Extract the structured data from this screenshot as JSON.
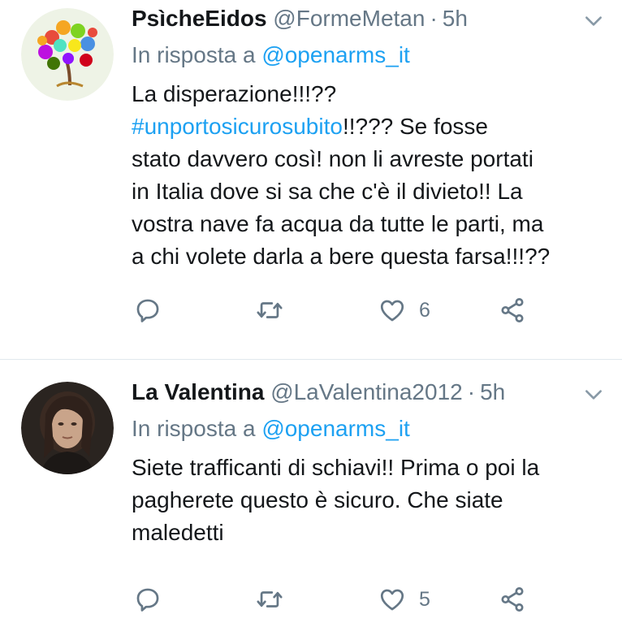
{
  "tweets": [
    {
      "author_name": "PsìcheEidos",
      "handle": "@FormeMetan",
      "separator": "·",
      "time": "5h",
      "reply_prefix": "In risposta a",
      "reply_to": "@openarms_it",
      "body_line1": "La disperazione!!!??",
      "hashtag": "#unportosicurosubito",
      "body_line2_rest": "!!??? Se fosse",
      "body_line3": "stato davvero così! non li avreste portati",
      "body_line4": "in Italia dove si sa che c'è il divieto!! La",
      "body_line5": "vostra nave fa acqua da tutte le parti, ma",
      "body_line6": "a chi volete darla a bere questa farsa!!!??",
      "like_count": "6",
      "avatar_icon": "colorful-tree-face-avatar"
    },
    {
      "author_name": "La Valentina",
      "handle": "@LaValentina2012",
      "separator": "·",
      "time": "5h",
      "reply_prefix": "In risposta a",
      "reply_to": "@openarms_it",
      "body_line1": "Siete trafficanti di schiavi!! Prima o poi la",
      "body_line2": "pagherete questo è sicuro. Che siate",
      "body_line3": "maledetti",
      "like_count": "5",
      "avatar_icon": "woman-portrait-avatar"
    }
  ],
  "icons": {
    "reply": "speech-bubble-icon",
    "retweet": "retweet-arrows-icon",
    "like": "heart-icon",
    "share": "share-nodes-icon",
    "menu": "chevron-down-icon"
  },
  "colors": {
    "link": "#1da1f2",
    "secondary": "#657786",
    "primary": "#14171a",
    "divider": "#e1e8ed"
  }
}
